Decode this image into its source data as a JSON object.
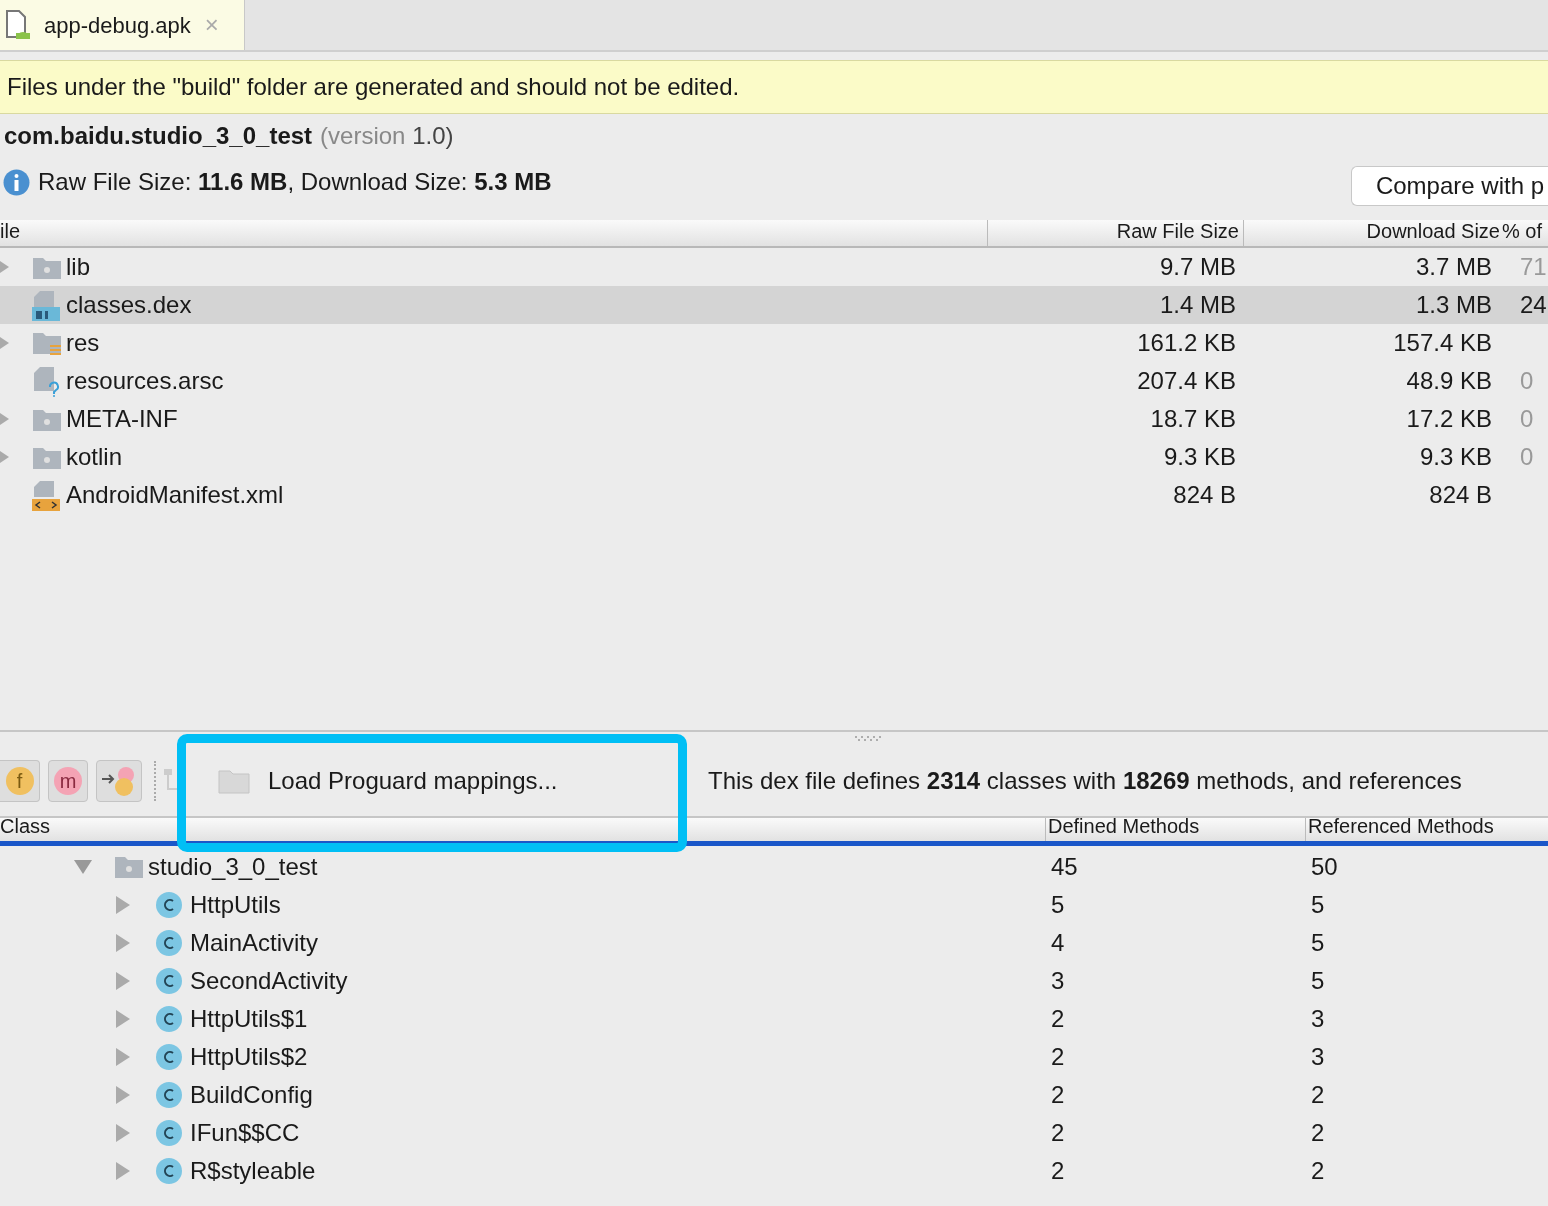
{
  "tab": {
    "label": "app-debug.apk",
    "close": "×",
    "selected": true
  },
  "banner": "Files under the \"build\" folder are generated and should not be edited.",
  "package": {
    "name": "com.baidu.studio_3_0_test",
    "version_label": "(version",
    "version": "1.0)"
  },
  "summary": "Raw File Size: **11.6 MB**, Download Size: **5.3 MB**",
  "compare_button": "Compare with p",
  "file_table": {
    "columns": [
      "ile",
      "Raw File Size",
      "Download Size",
      "% of"
    ],
    "rows": [
      {
        "name": "lib",
        "kind": "folder",
        "expandable": true,
        "raw": "9.7 MB",
        "download": "3.7 MB",
        "percent": "71",
        "selected": false
      },
      {
        "name": "classes.dex",
        "kind": "dex",
        "expandable": false,
        "raw": "1.4 MB",
        "download": "1.3 MB",
        "percent": "24",
        "selected": true
      },
      {
        "name": "res",
        "kind": "res",
        "expandable": true,
        "raw": "161.2 KB",
        "download": "157.4 KB",
        "selected": false
      },
      {
        "name": "resources.arsc",
        "kind": "arsc",
        "expandable": false,
        "raw": "207.4 KB",
        "download": "48.9 KB",
        "percent": "0",
        "selected": false
      },
      {
        "name": "META-INF",
        "kind": "folder",
        "expandable": true,
        "raw": "18.7 KB",
        "download": "17.2 KB",
        "percent": "0",
        "selected": false
      },
      {
        "name": "kotlin",
        "kind": "folder",
        "expandable": true,
        "raw": "9.3 KB",
        "download": "9.3 KB",
        "percent": "0",
        "selected": false
      },
      {
        "name": "AndroidManifest.xml",
        "kind": "xml",
        "expandable": false,
        "raw": "824 B",
        "download": "824 B",
        "selected": false
      }
    ]
  },
  "toolbar": {
    "filters": [
      "f",
      "m"
    ],
    "load_button": "Load Proguard mappings...",
    "info": "This dex file defines **2314** classes with **18269** methods, and references"
  },
  "class_table": {
    "columns": [
      "Class",
      "Defined Methods",
      "Referenced Methods"
    ],
    "rows": [
      {
        "name": "studio_3_0_test",
        "kind": "package",
        "expanded": true,
        "defined": "45",
        "referenced": "50",
        "children": [
          {
            "name": "HttpUtils",
            "kind": "class",
            "expanded": false,
            "defined": "5",
            "referenced": "5"
          },
          {
            "name": "MainActivity",
            "kind": "class",
            "expanded": false,
            "defined": "4",
            "referenced": "5"
          },
          {
            "name": "SecondActivity",
            "kind": "class",
            "expanded": false,
            "defined": "3",
            "referenced": "5"
          },
          {
            "name": "HttpUtils$1",
            "kind": "class",
            "expanded": false,
            "defined": "2",
            "referenced": "3"
          },
          {
            "name": "HttpUtils$2",
            "kind": "class",
            "expanded": false,
            "defined": "2",
            "referenced": "3"
          },
          {
            "name": "BuildConfig",
            "kind": "class",
            "expanded": false,
            "defined": "2",
            "referenced": "2"
          },
          {
            "name": "IFun$$CC",
            "kind": "class",
            "expanded": false,
            "defined": "2",
            "referenced": "2"
          },
          {
            "name": "R$styleable",
            "kind": "class",
            "expanded": false,
            "defined": "2",
            "referenced": "2"
          }
        ]
      }
    ]
  }
}
